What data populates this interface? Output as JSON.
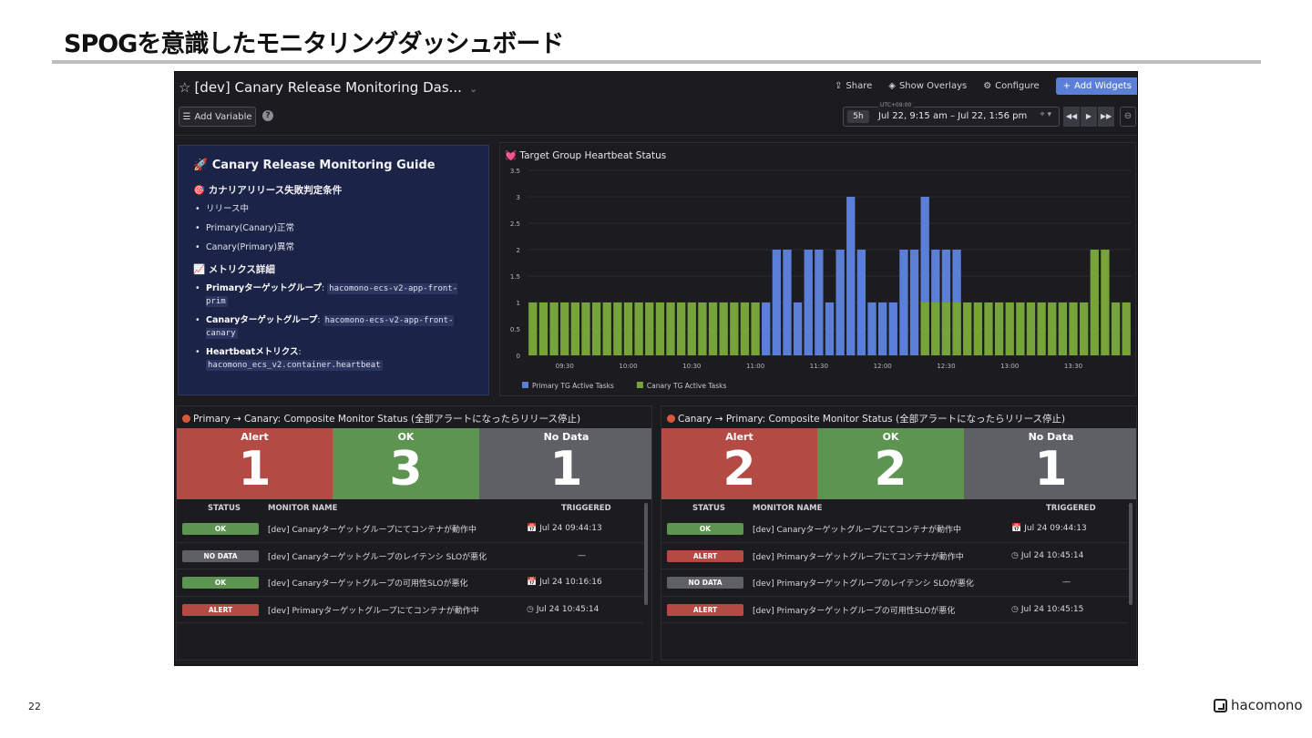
{
  "slide": {
    "title": "SPOGを意識したモニタリングダッシュボード",
    "page_number": "22",
    "brand": "hacomono"
  },
  "dashboard": {
    "title": "[dev] Canary Release Monitoring Das...",
    "add_variable": "Add Variable",
    "help": "?",
    "share": "Share",
    "show_overlays": "Show Overlays",
    "configure": "Configure",
    "add_widgets": "Add Widgets",
    "timezone": "UTC+09:00",
    "span": "5h",
    "time_range": "Jul 22, 9:15 am – Jul 22, 1:56 pm"
  },
  "guide": {
    "title": "🚀 Canary Release Monitoring Guide",
    "section1": "🎯 カナリアリリース失敗判定条件",
    "conditions": [
      "リリース中",
      "Primary(Canary)正常",
      "Canary(Primary)異常"
    ],
    "section2": "📈 メトリクス詳細",
    "primary_label": "Primaryターゲットグループ",
    "primary_value": "hacomono-ecs-v2-app-front-prim",
    "canary_label": "Canaryターゲットグループ",
    "canary_value": "hacomono-ecs-v2-app-front-canary",
    "heartbeat_label": "Heartbeatメトリクス",
    "heartbeat_value": "hacomono_ecs_v2.container.heartbeat"
  },
  "chart_data": {
    "type": "bar",
    "title": "💓 Target Group Heartbeat Status",
    "stacked": false,
    "ylim": [
      0,
      3.5
    ],
    "y_ticks": [
      "0",
      "0.5",
      "1",
      "1.5",
      "2",
      "2.5",
      "3",
      "3.5"
    ],
    "x_ticks": [
      "09:30",
      "10:00",
      "10:30",
      "11:00",
      "11:30",
      "12:00",
      "12:30",
      "13:00",
      "13:30"
    ],
    "series": [
      {
        "name": "Primary TG Active Tasks",
        "color": "#5b7fd6",
        "values": [
          0,
          0,
          0,
          0,
          0,
          0,
          0,
          0,
          0,
          0,
          0,
          0,
          0,
          0,
          0,
          0,
          0,
          0,
          0,
          0,
          0,
          0,
          1,
          2,
          2,
          1,
          2,
          2,
          1,
          2,
          3,
          2,
          1,
          1,
          1,
          2,
          2,
          3,
          2,
          2,
          2,
          0,
          0,
          0,
          0,
          0,
          0,
          0,
          0,
          0,
          0,
          0,
          0,
          0,
          0,
          0,
          0
        ]
      },
      {
        "name": "Canary TG Active Tasks",
        "color": "#76a33a",
        "values": [
          1,
          1,
          1,
          1,
          1,
          1,
          1,
          1,
          1,
          1,
          1,
          1,
          1,
          1,
          1,
          1,
          1,
          1,
          1,
          1,
          1,
          1,
          0,
          0,
          0,
          0,
          0,
          0,
          0,
          0,
          0,
          0,
          0,
          0,
          0,
          0,
          0,
          1,
          1,
          1,
          1,
          1,
          1,
          1,
          1,
          1,
          1,
          1,
          1,
          1,
          1,
          1,
          1,
          2,
          2,
          1,
          1
        ]
      }
    ]
  },
  "monitor_left": {
    "title": "Primary → Canary: Composite Monitor Status (全部アラートになったらリリース停止)",
    "alert_label": "Alert",
    "alert_count": "1",
    "ok_label": "OK",
    "ok_count": "3",
    "nodata_label": "No Data",
    "nodata_count": "1",
    "col_status": "STATUS",
    "col_name": "MONITOR NAME",
    "col_triggered": "TRIGGERED",
    "rows": [
      {
        "status": "OK",
        "kind": "ok",
        "name": "[dev] Canaryターゲットグループにてコンテナが動作中",
        "triggered": "Jul 24 09:44:13",
        "icon": "📅"
      },
      {
        "status": "NO DATA",
        "kind": "nodata",
        "name": "[dev] Canaryターゲットグループのレイテンシ SLOが悪化",
        "triggered": "—",
        "icon": ""
      },
      {
        "status": "OK",
        "kind": "ok",
        "name": "[dev] Canaryターゲットグループの可用性SLOが悪化",
        "triggered": "Jul 24 10:16:16",
        "icon": "📅"
      },
      {
        "status": "ALERT",
        "kind": "alert",
        "name": "[dev] Primaryターゲットグループにてコンテナが動作中",
        "triggered": "Jul 24 10:45:14",
        "icon": "◷"
      }
    ]
  },
  "monitor_right": {
    "title": "Canary → Primary: Composite Monitor Status (全部アラートになったらリリース停止)",
    "alert_label": "Alert",
    "alert_count": "2",
    "ok_label": "OK",
    "ok_count": "2",
    "nodata_label": "No Data",
    "nodata_count": "1",
    "col_status": "STATUS",
    "col_name": "MONITOR NAME",
    "col_triggered": "TRIGGERED",
    "rows": [
      {
        "status": "OK",
        "kind": "ok",
        "name": "[dev] Canaryターゲットグループにてコンテナが動作中",
        "triggered": "Jul 24 09:44:13",
        "icon": "📅"
      },
      {
        "status": "ALERT",
        "kind": "alert",
        "name": "[dev] Primaryターゲットグループにてコンテナが動作中",
        "triggered": "Jul 24 10:45:14",
        "icon": "◷"
      },
      {
        "status": "NO DATA",
        "kind": "nodata",
        "name": "[dev] Primaryターゲットグループのレイテンシ SLOが悪化",
        "triggered": "—",
        "icon": ""
      },
      {
        "status": "ALERT",
        "kind": "alert",
        "name": "[dev] Primaryターゲットグループの可用性SLOが悪化",
        "triggered": "Jul 24 10:45:15",
        "icon": "◷"
      }
    ]
  }
}
